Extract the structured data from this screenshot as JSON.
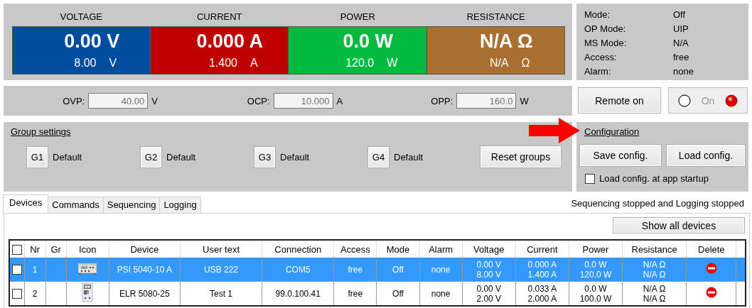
{
  "meters": [
    {
      "label": "VOLTAGE",
      "color": "#004c9e",
      "value": "0.00 V",
      "limit": "8.00",
      "unit": "V"
    },
    {
      "label": "CURRENT",
      "color": "#c00000",
      "value": "0.000 A",
      "limit": "1.400",
      "unit": "A"
    },
    {
      "label": "POWER",
      "color": "#00bb40",
      "value": "0.0 W",
      "limit": "120.0",
      "unit": "W"
    },
    {
      "label": "RESISTANCE",
      "color": "#a86f30",
      "value": "N/A Ω",
      "limit": "N/A",
      "unit": "Ω"
    }
  ],
  "status": [
    {
      "label": "Mode:",
      "value": "Off"
    },
    {
      "label": "OP Mode:",
      "value": "UIP"
    },
    {
      "label": "MS Mode:",
      "value": "N/A"
    },
    {
      "label": "Access:",
      "value": "free"
    },
    {
      "label": "Alarm:",
      "value": "none"
    }
  ],
  "protection": [
    {
      "label": "OVP:",
      "value": "40.00",
      "unit": "V"
    },
    {
      "label": "OCP:",
      "value": "10.000",
      "unit": "A"
    },
    {
      "label": "OPP:",
      "value": "160.0",
      "unit": "W"
    }
  ],
  "remote_button": "Remote on",
  "output": {
    "label": "On",
    "on": false
  },
  "group_settings": {
    "title": "Group settings",
    "groups": [
      {
        "button": "G1",
        "name": "Default"
      },
      {
        "button": "G2",
        "name": "Default"
      },
      {
        "button": "G3",
        "name": "Default"
      },
      {
        "button": "G4",
        "name": "Default"
      }
    ],
    "reset_button": "Reset groups"
  },
  "configuration": {
    "title": "Configuration",
    "buttons": [
      "Save config.",
      "Load config."
    ],
    "startup": {
      "label": "Load config. at app startup",
      "checked": false
    }
  },
  "tabs": [
    {
      "label": "Devices",
      "selected": true
    },
    {
      "label": "Commands",
      "selected": false
    },
    {
      "label": "Sequencing",
      "selected": false
    },
    {
      "label": "Logging",
      "selected": false
    }
  ],
  "status_text": "Sequencing stopped and Logging stopped",
  "show_all_button": "Show all devices",
  "table": {
    "columns": [
      "Nr",
      "Gr",
      "Icon",
      "Device",
      "User text",
      "Connection",
      "Access",
      "Mode",
      "Alarm",
      "Voltage",
      "Current",
      "Power",
      "Resistance",
      "Delete"
    ],
    "all_checked": false,
    "rows": [
      {
        "selected": true,
        "checked": false,
        "nr": "1",
        "kind": "bench",
        "device": "PSI 5040-10 A",
        "user_text": "USB 222",
        "connection": "COM5",
        "access": "free",
        "mode": "Off",
        "alarm": "none",
        "voltage": [
          "0.00 V",
          "8.00 V"
        ],
        "current": [
          "0.000 A",
          "1.400 A"
        ],
        "power": [
          "0.0 W",
          "120.0 W"
        ],
        "resistance": [
          "N/A Ω",
          "N/A Ω"
        ]
      },
      {
        "selected": false,
        "checked": false,
        "nr": "2",
        "kind": "tower",
        "device": "ELR 5080-25",
        "user_text": "Test 1",
        "connection": "99.0.100.41",
        "access": "free",
        "mode": "Off",
        "alarm": "none",
        "voltage": [
          "0.00 V",
          "2.00 V"
        ],
        "current": [
          "0.033 A",
          "2.000 A"
        ],
        "power": [
          "0.0 W",
          "100.0 W"
        ],
        "resistance": [
          "N/A Ω",
          "N/A Ω"
        ]
      }
    ]
  }
}
